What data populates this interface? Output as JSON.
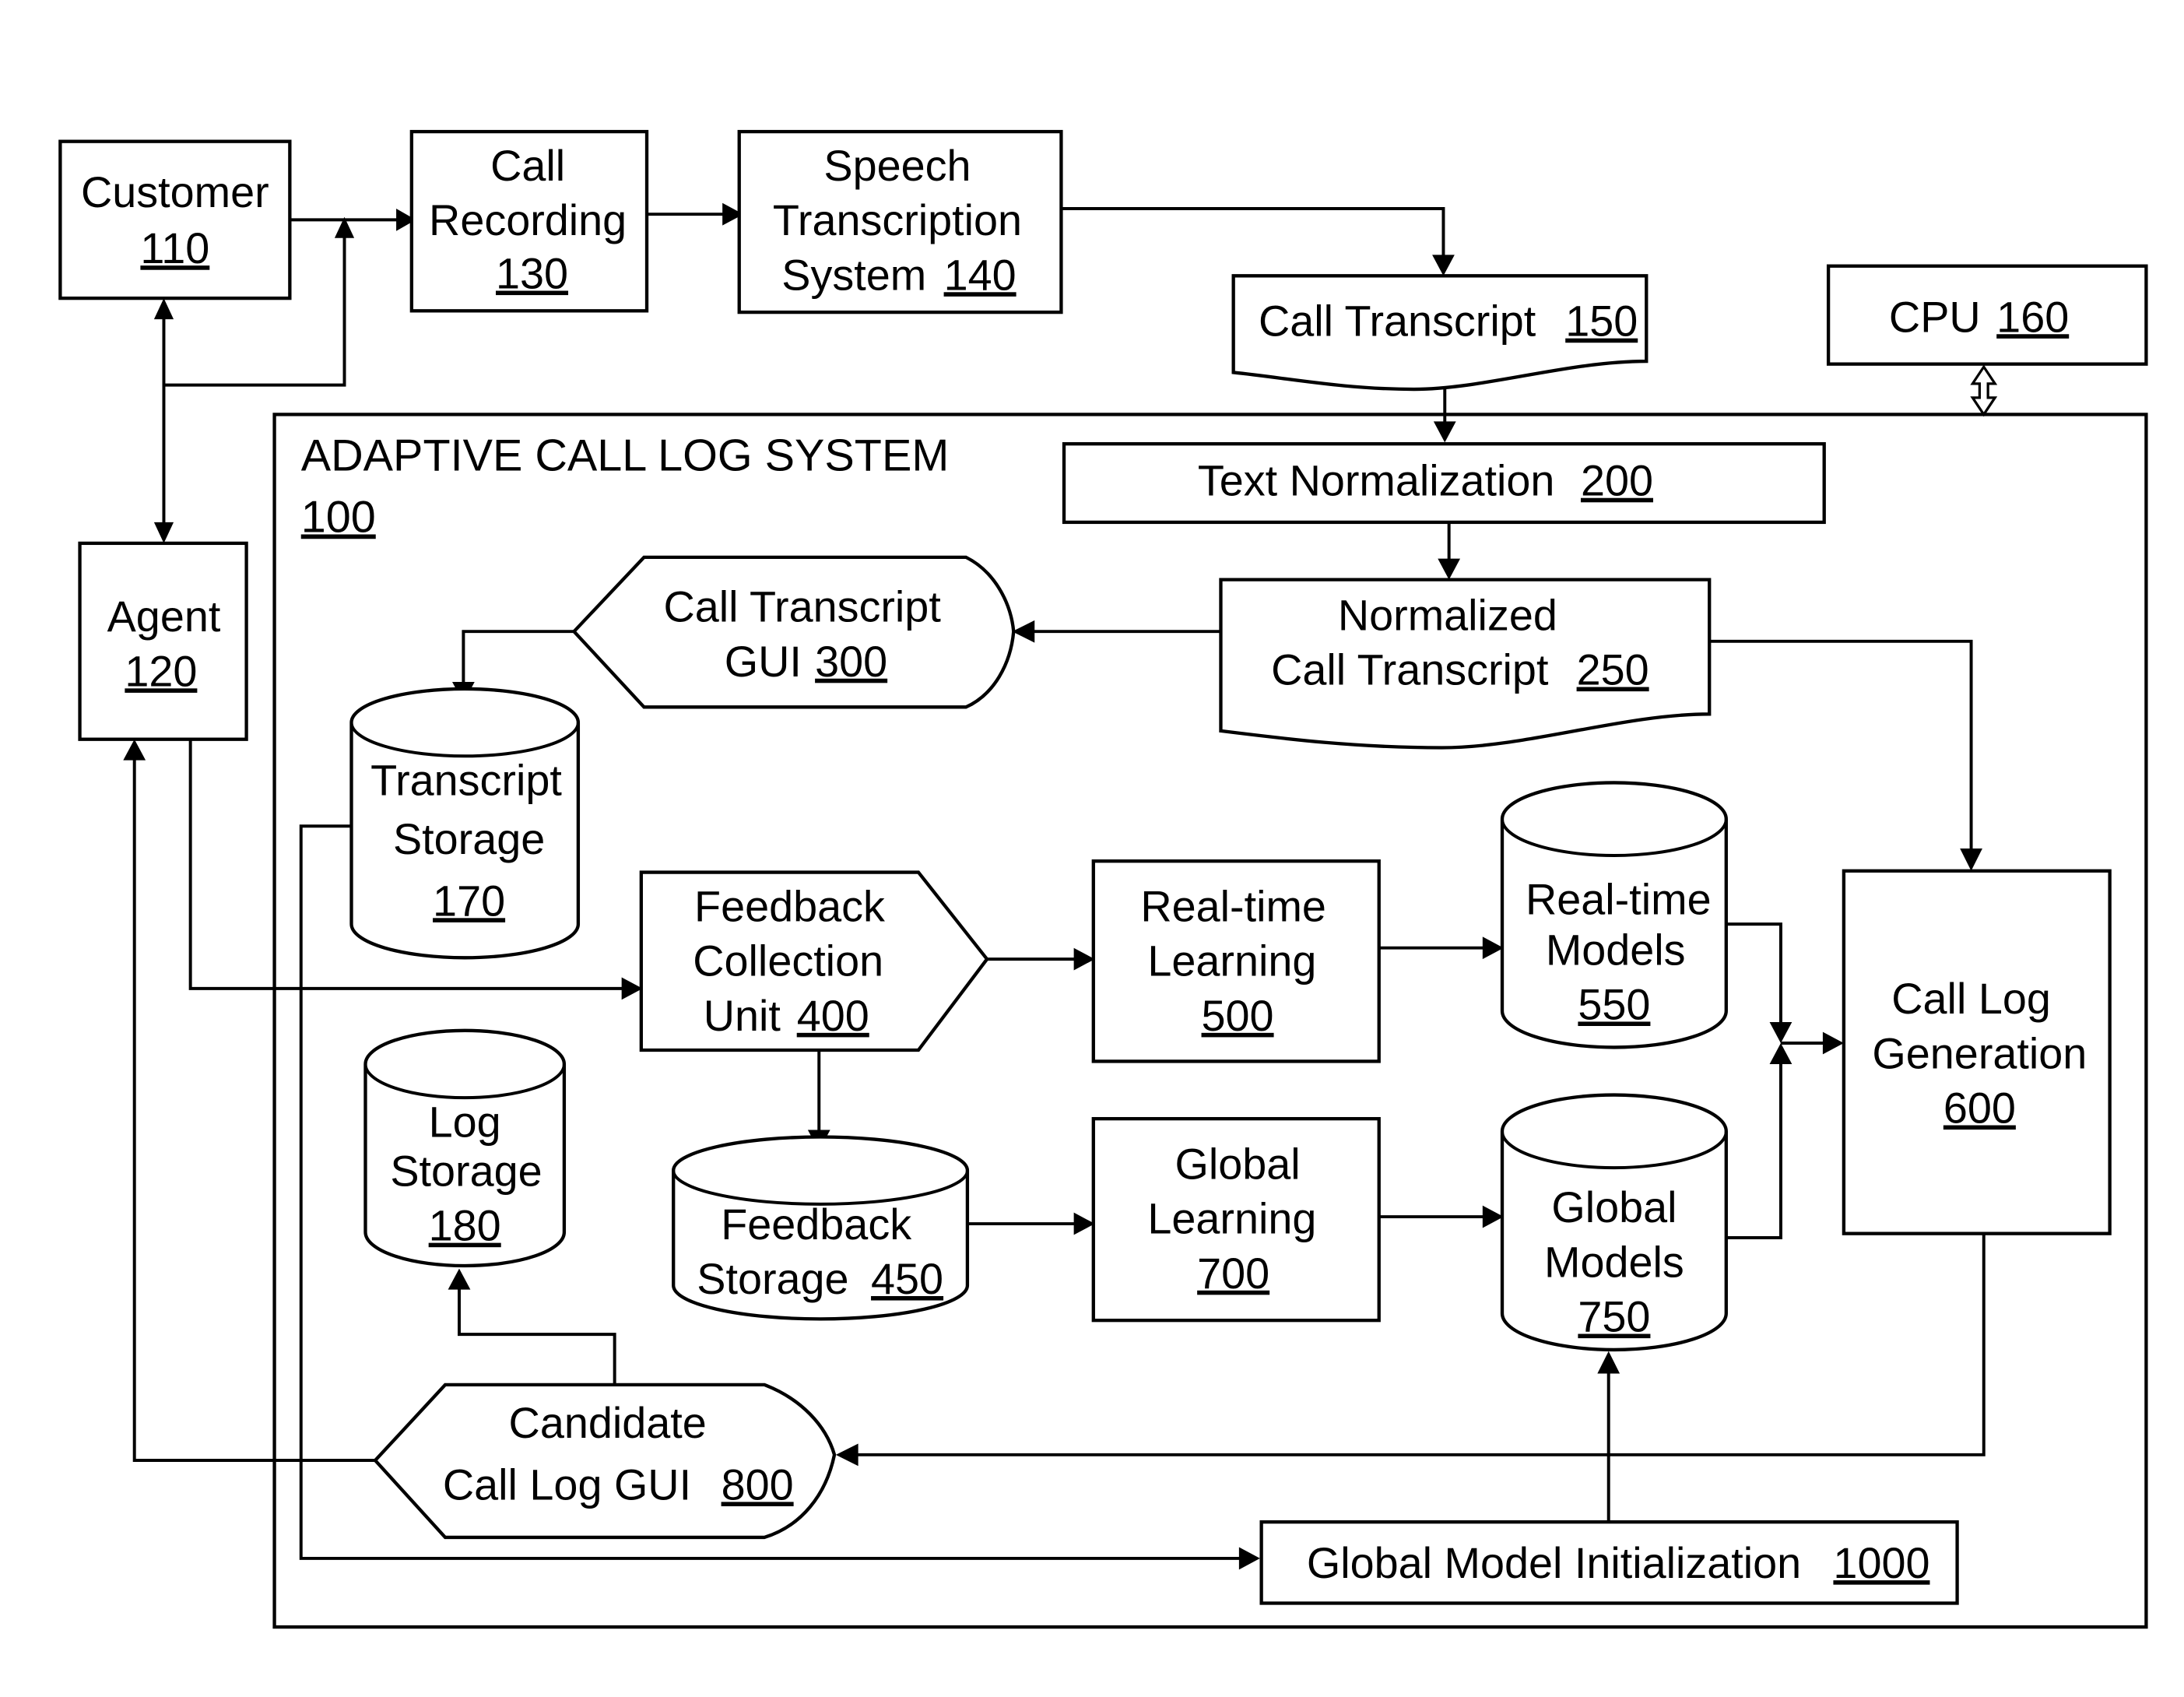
{
  "diagram": {
    "system": {
      "title": "ADAPTIVE CALL LOG SYSTEM",
      "ref": "100"
    },
    "nodes": {
      "customer": {
        "lines": [
          "Customer"
        ],
        "ref": "110"
      },
      "agent": {
        "lines": [
          "Agent"
        ],
        "ref": "120"
      },
      "call_recording": {
        "lines": [
          "Call",
          "Recording"
        ],
        "ref": "130"
      },
      "speech_transcription": {
        "lines": [
          "Speech",
          "Transcription",
          "System"
        ],
        "ref": "140"
      },
      "call_transcript": {
        "lines": [
          "Call Transcript"
        ],
        "ref": "150"
      },
      "cpu": {
        "lines": [
          "CPU"
        ],
        "ref": "160"
      },
      "transcript_storage": {
        "lines": [
          "Transcript",
          "Storage"
        ],
        "ref": "170"
      },
      "log_storage": {
        "lines": [
          "Log",
          "Storage"
        ],
        "ref": "180"
      },
      "text_normalization": {
        "lines": [
          "Text Normalization"
        ],
        "ref": "200"
      },
      "normalized_call_transcript": {
        "lines": [
          "Normalized",
          "Call Transcript"
        ],
        "ref": "250"
      },
      "call_transcript_gui": {
        "lines": [
          "Call Transcript",
          "GUI"
        ],
        "ref": "300"
      },
      "feedback_collection": {
        "lines": [
          "Feedback",
          "Collection",
          "Unit"
        ],
        "ref": "400"
      },
      "feedback_storage": {
        "lines": [
          "Feedback",
          "Storage"
        ],
        "ref": "450"
      },
      "realtime_learning": {
        "lines": [
          "Real-time",
          "Learning"
        ],
        "ref": "500"
      },
      "realtime_models": {
        "lines": [
          "Real-time",
          "Models"
        ],
        "ref": "550"
      },
      "call_log_generation": {
        "lines": [
          "Call Log",
          "Generation"
        ],
        "ref": "600"
      },
      "global_learning": {
        "lines": [
          "Global",
          "Learning"
        ],
        "ref": "700"
      },
      "global_models": {
        "lines": [
          "Global",
          "Models"
        ],
        "ref": "750"
      },
      "candidate_call_log_gui": {
        "lines": [
          "Candidate",
          "Call Log GUI"
        ],
        "ref": "800"
      },
      "global_model_initialization": {
        "lines": [
          "Global Model Initialization"
        ],
        "ref": "1000"
      }
    }
  }
}
